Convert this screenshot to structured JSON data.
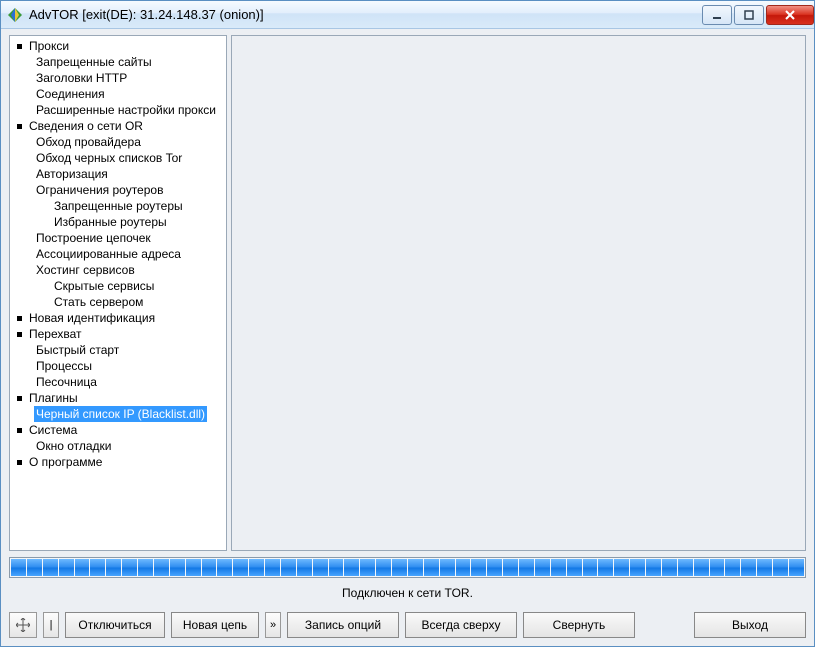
{
  "window": {
    "title": "AdvTOR [exit(DE): 31.24.148.37 (onion)]"
  },
  "tree": {
    "items": [
      {
        "depth": 0,
        "bullet": true,
        "label": "Прокси",
        "sel": false
      },
      {
        "depth": 1,
        "bullet": false,
        "label": "Запрещенные сайты",
        "sel": false
      },
      {
        "depth": 1,
        "bullet": false,
        "label": "Заголовки HTTP",
        "sel": false
      },
      {
        "depth": 1,
        "bullet": false,
        "label": "Соединения",
        "sel": false
      },
      {
        "depth": 1,
        "bullet": false,
        "label": "Расширенные настройки прокси",
        "sel": false
      },
      {
        "depth": 0,
        "bullet": true,
        "label": "Сведения о сети OR",
        "sel": false
      },
      {
        "depth": 1,
        "bullet": false,
        "label": "Обход провайдера",
        "sel": false
      },
      {
        "depth": 1,
        "bullet": false,
        "label": "Обход черных списков Tor",
        "sel": false
      },
      {
        "depth": 1,
        "bullet": false,
        "label": "Авторизация",
        "sel": false
      },
      {
        "depth": 1,
        "bullet": false,
        "label": "Ограничения роутеров",
        "sel": false
      },
      {
        "depth": 2,
        "bullet": false,
        "label": "Запрещенные роутеры",
        "sel": false
      },
      {
        "depth": 2,
        "bullet": false,
        "label": "Избранные роутеры",
        "sel": false
      },
      {
        "depth": 1,
        "bullet": false,
        "label": "Построение цепочек",
        "sel": false
      },
      {
        "depth": 1,
        "bullet": false,
        "label": "Ассоциированные адреса",
        "sel": false
      },
      {
        "depth": 1,
        "bullet": false,
        "label": "Хостинг сервисов",
        "sel": false
      },
      {
        "depth": 2,
        "bullet": false,
        "label": "Скрытые сервисы",
        "sel": false
      },
      {
        "depth": 2,
        "bullet": false,
        "label": "Стать сервером",
        "sel": false
      },
      {
        "depth": 0,
        "bullet": true,
        "label": "Новая идентификация",
        "sel": false
      },
      {
        "depth": 0,
        "bullet": true,
        "label": "Перехват",
        "sel": false
      },
      {
        "depth": 1,
        "bullet": false,
        "label": "Быстрый старт",
        "sel": false
      },
      {
        "depth": 1,
        "bullet": false,
        "label": "Процессы",
        "sel": false
      },
      {
        "depth": 1,
        "bullet": false,
        "label": "Песочница",
        "sel": false
      },
      {
        "depth": 0,
        "bullet": true,
        "label": "Плагины",
        "sel": false
      },
      {
        "depth": 1,
        "bullet": false,
        "label": "Черный список IP (Blacklist.dll)",
        "sel": true
      },
      {
        "depth": 0,
        "bullet": true,
        "label": "Система",
        "sel": false
      },
      {
        "depth": 1,
        "bullet": false,
        "label": "Окно отладки",
        "sel": false
      },
      {
        "depth": 0,
        "bullet": true,
        "label": "О программе",
        "sel": false
      }
    ]
  },
  "progress": {
    "segments": 50
  },
  "status": {
    "text": "Подключен к сети TOR."
  },
  "buttons": {
    "disconnect": "Отключиться",
    "newchain": "Новая цепь",
    "newchain_adj": "»",
    "saveopts": "Запись опций",
    "alwaysontop": "Всегда сверху",
    "minimize": "Свернуть",
    "exit": "Выход"
  }
}
